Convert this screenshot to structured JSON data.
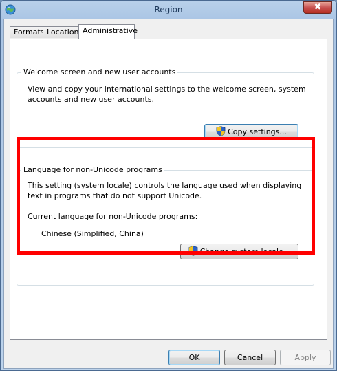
{
  "window": {
    "title": "Region",
    "close_label": "✖"
  },
  "tabs": [
    {
      "label": "Formats"
    },
    {
      "label": "Location"
    },
    {
      "label": "Administrative"
    }
  ],
  "welcome_group": {
    "title": "Welcome screen and new user accounts",
    "description_line1": "View and copy your international settings to the welcome screen, system",
    "description_line2": "accounts and new user accounts.",
    "copy_button": "Copy settings..."
  },
  "locale_group": {
    "title": "Language for non-Unicode programs",
    "description_line1": "This setting (system locale) controls the language used when displaying",
    "description_line2": "text in programs that do not support Unicode.",
    "current_label": "Current language for non-Unicode programs:",
    "current_value": "Chinese (Simplified, China)",
    "change_button": "Change system locale..."
  },
  "footer": {
    "ok": "OK",
    "cancel": "Cancel",
    "apply": "Apply"
  },
  "icons": {
    "app": "globe-icon",
    "uac": "uac-shield-icon"
  },
  "colors": {
    "highlight": "#ff0000"
  }
}
